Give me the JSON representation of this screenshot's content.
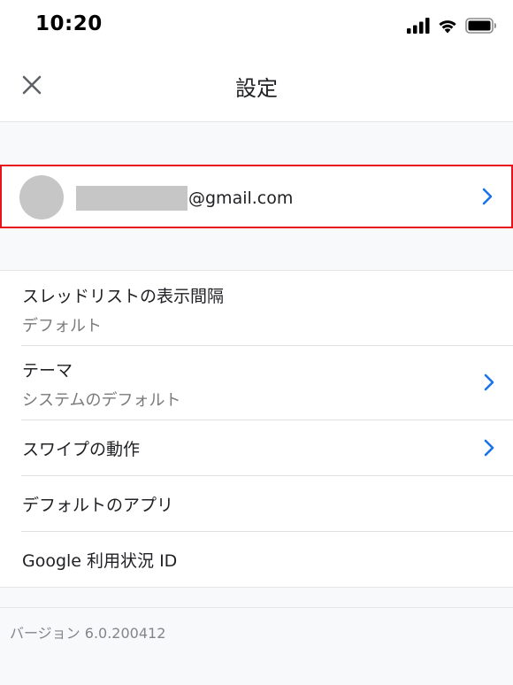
{
  "status_bar": {
    "time": "10:20",
    "icons": [
      "signal-icon",
      "wifi-icon",
      "battery-icon"
    ]
  },
  "header": {
    "title": "設定",
    "close_icon": "close-icon"
  },
  "account": {
    "email_suffix": "@gmail.com",
    "chevron_icon": "chevron-right-icon",
    "highlight_color": "#e8141c"
  },
  "settings": [
    {
      "title": "スレッドリストの表示間隔",
      "subtitle": "デフォルト",
      "chevron": false
    },
    {
      "title": "テーマ",
      "subtitle": "システムのデフォルト",
      "chevron": true
    },
    {
      "title": "スワイプの動作",
      "subtitle": "",
      "chevron": true
    },
    {
      "title": "デフォルトのアプリ",
      "subtitle": "",
      "chevron": false
    },
    {
      "title": "Google 利用状況 ID",
      "subtitle": "",
      "chevron": false
    }
  ],
  "footer": {
    "version": "バージョン 6.0.200412"
  },
  "colors": {
    "accent": "#1a73e8",
    "background": "#f8f9fa"
  }
}
